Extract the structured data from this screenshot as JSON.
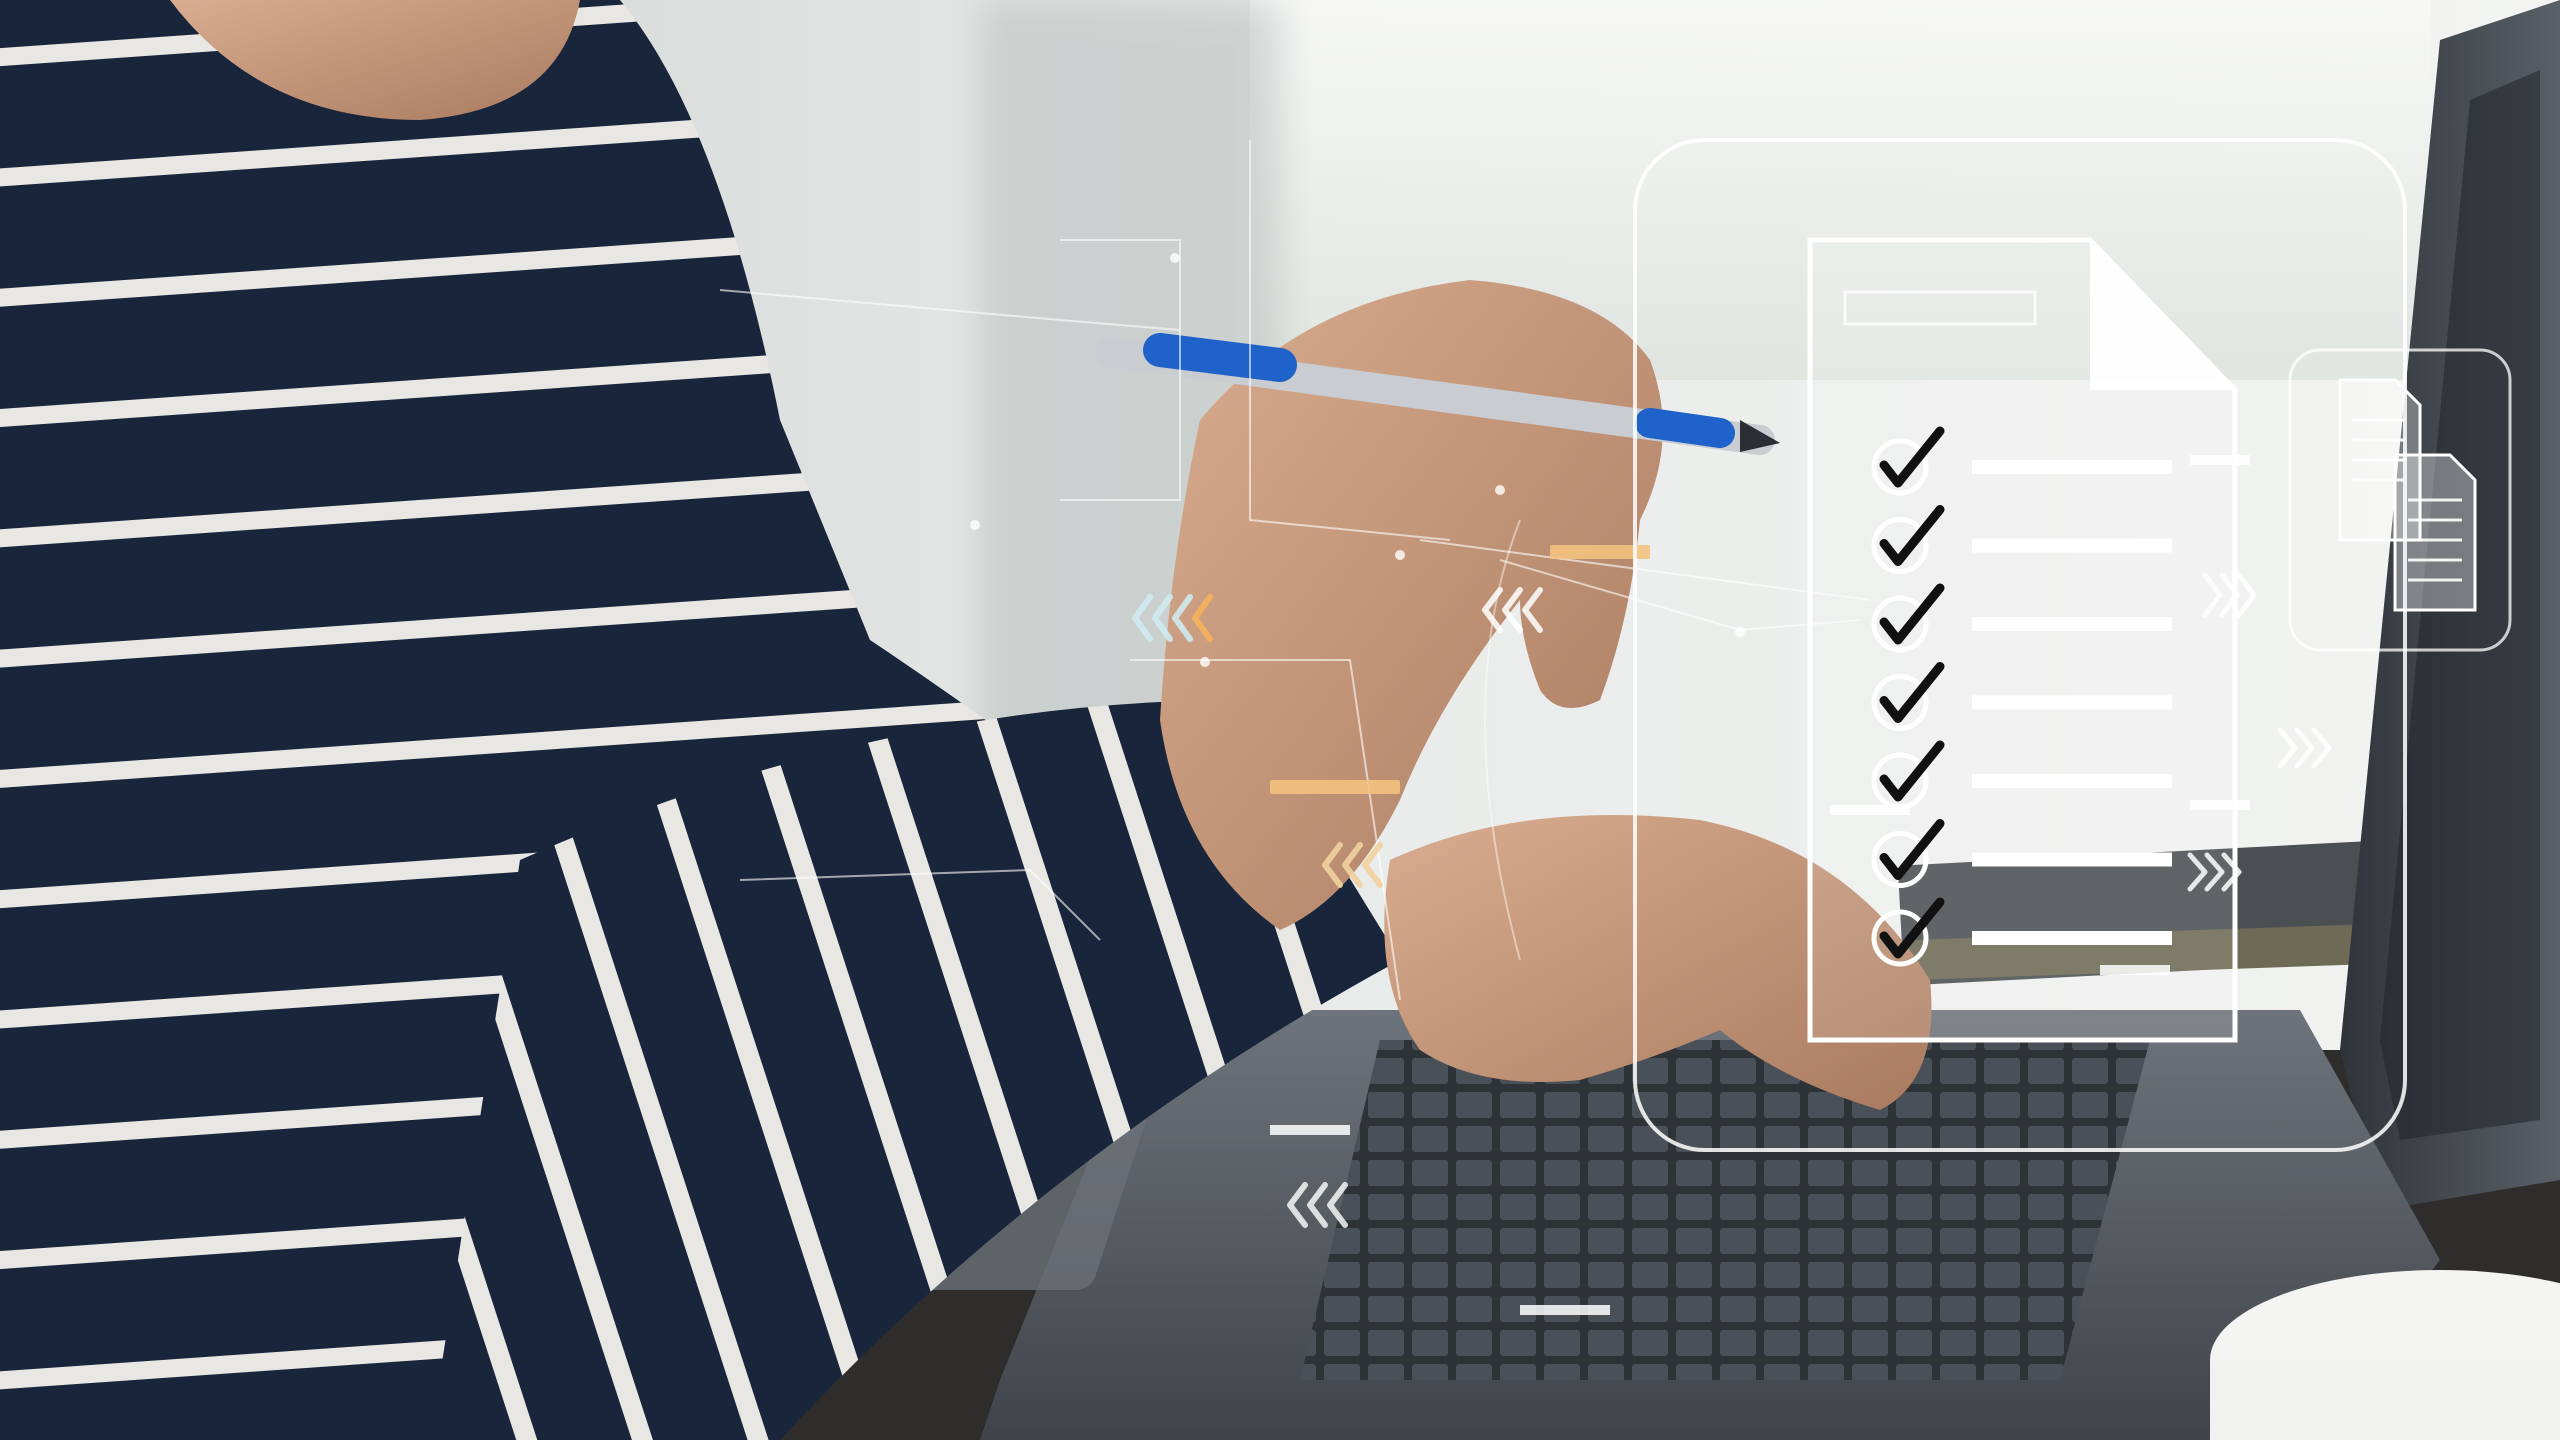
{
  "scene": {
    "description_alt": "",
    "checklist": {
      "items": [
        true,
        true,
        true,
        true,
        true,
        true,
        true
      ]
    },
    "colors": {
      "background_light": "#eef0ef",
      "background_mid": "#c9cdcc",
      "shirt_navy": "#18253a",
      "shirt_stripe": "#e7e6e3",
      "skin": "#c79a7d",
      "skin_shadow": "#9b6f56",
      "pen_blue": "#1f62c9",
      "pen_metal": "#c9ccd1",
      "laptop_body": "#5b6067",
      "laptop_dark": "#2b3036",
      "keys": "#3b4046",
      "desk": "#3c3a37",
      "overlay_white": "#ffffff",
      "accent_orange": "#f2b15c"
    },
    "icons": [
      "document-checklist-icon",
      "stacked-documents-icon",
      "chevron-left-icon",
      "chevron-right-icon",
      "checkmark-icon"
    ]
  }
}
